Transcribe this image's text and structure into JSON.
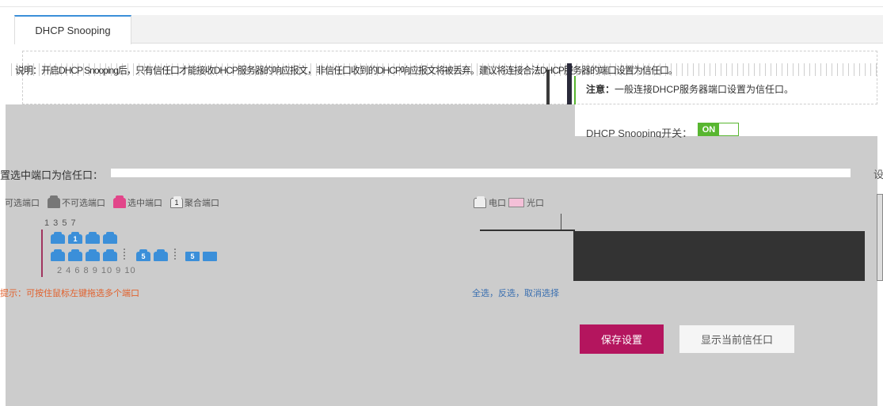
{
  "tabs": [
    {
      "label": "DHCP Snooping"
    }
  ],
  "notice": {
    "garbled_text": "ﾠ说明：开启DHCP Snooping后，只有信任口才能接收DHCP服务器的响应报文，非信任口收到的DHCP响应报文将被丢弃。建议将连接合法DHCP服务器的端口设置为信任口。",
    "note_label": "注意：",
    "note_text": "一般连接DHCP服务器端口设置为信任口。"
  },
  "switch": {
    "label": "DHCP Snooping开关：",
    "state": "ON",
    "color": "#58b630"
  },
  "section": {
    "title": "置选中端口为信任口：",
    "right_char": "设"
  },
  "legend": [
    {
      "icon": "port-gray-icon",
      "label": "可选端口"
    },
    {
      "icon": "port-disabled-icon",
      "label": "不可选端口"
    },
    {
      "icon": "port-selected-icon",
      "label": "选中端口"
    },
    {
      "icon": "port-aggregate-icon",
      "badge": "1",
      "label": "聚合端口"
    }
  ],
  "legend2": [
    {
      "icon": "electric-port-icon",
      "label": "电口"
    },
    {
      "icon": "fiber-port-icon",
      "label": "光口"
    }
  ],
  "ports": {
    "top_numbers": "1 3 5 7",
    "bottom_numbers": "2  4  6  8   9  10   9  10",
    "top_row": [
      {
        "badge": ""
      },
      {
        "badge": "1"
      },
      {
        "badge": ""
      },
      {
        "badge": ""
      }
    ],
    "bottom_row": [
      {
        "badge": ""
      },
      {
        "badge": ""
      },
      {
        "badge": ""
      },
      {
        "badge": ""
      },
      {
        "badge": "5"
      },
      {
        "badge": ""
      },
      {
        "badge": "5"
      },
      {
        "badge": ""
      }
    ],
    "accent_color": "#3b8fd9"
  },
  "tip": "提示：可按住鼠标左键拖选多个端口",
  "links": {
    "select_all": "全选",
    "invert": "反选",
    "cancel": "取消选择"
  },
  "buttons": {
    "save": "保存设置",
    "show": "显示当前信任口"
  },
  "colors": {
    "primary": "#b4155e",
    "tab_accent": "#3b8fd9",
    "tip": "#e1612d"
  }
}
